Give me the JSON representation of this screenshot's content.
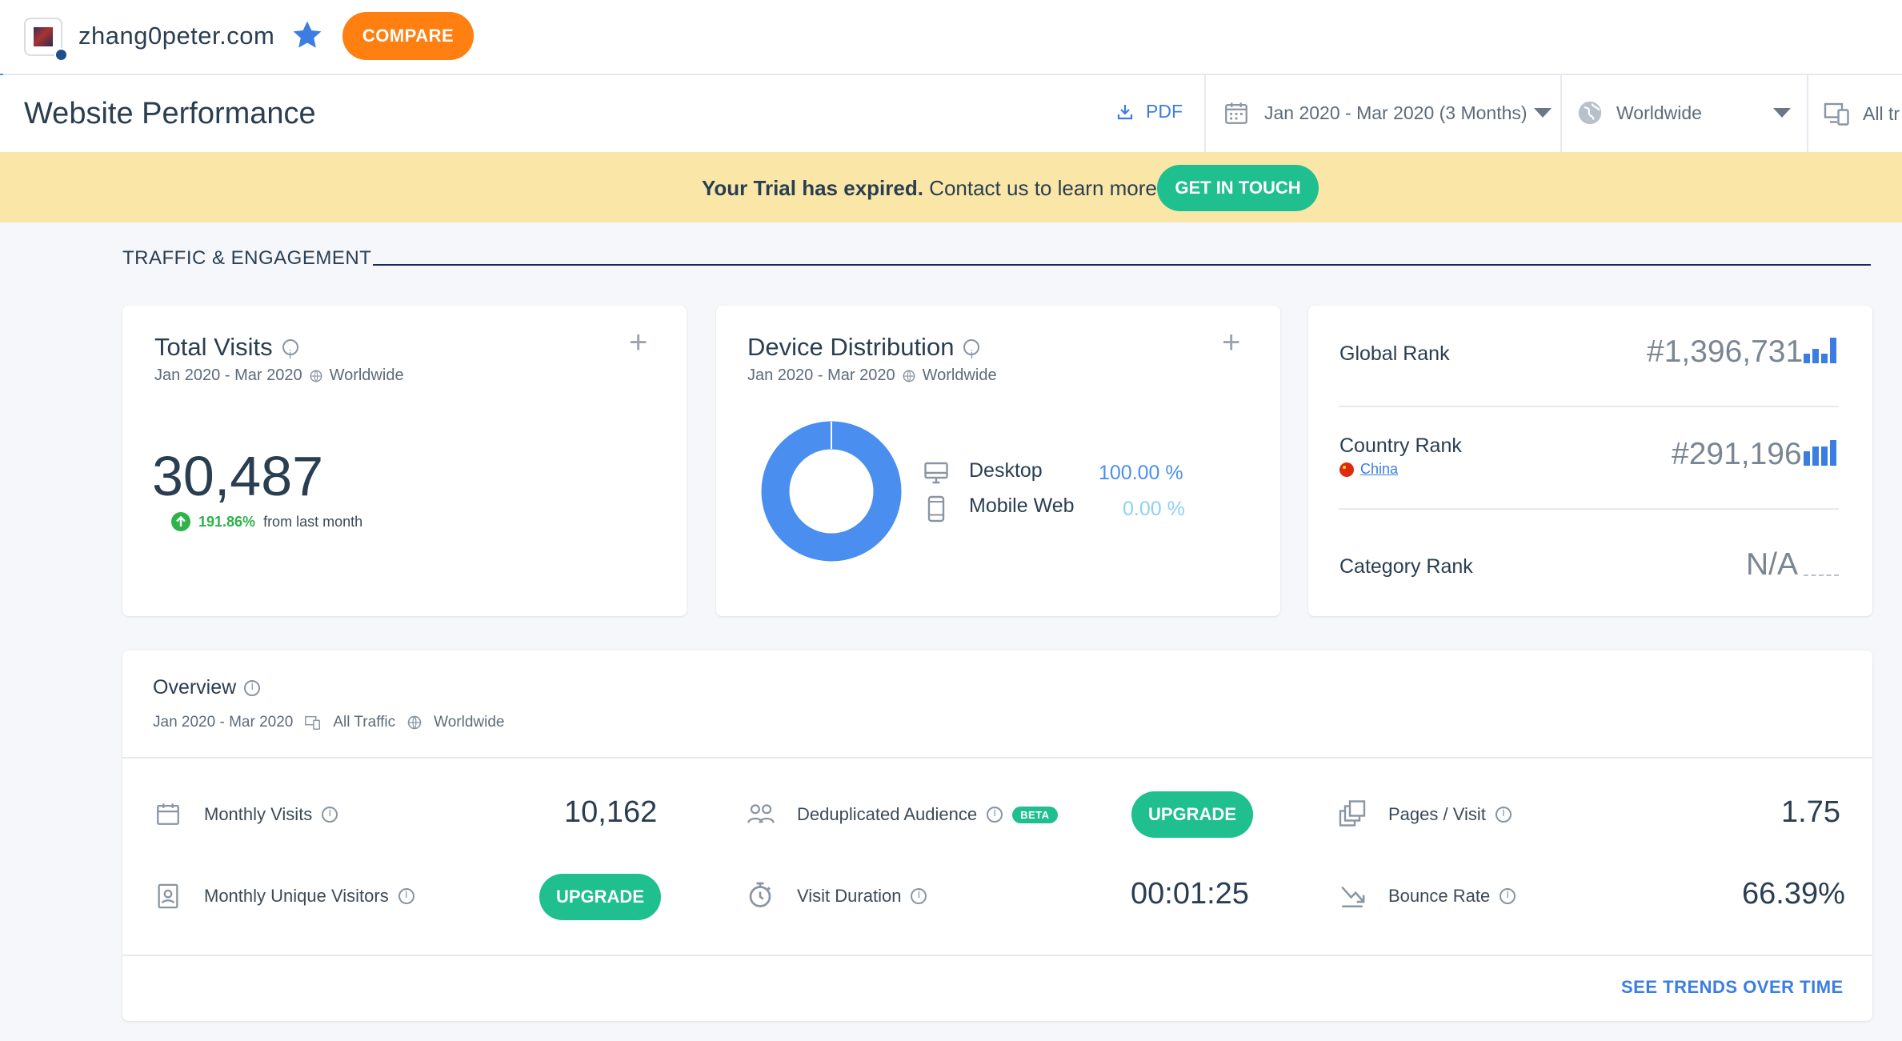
{
  "topbar": {
    "domain": "zhang0peter.com",
    "compare_label": "COMPARE"
  },
  "header": {
    "title": "Website Performance",
    "pdf_label": "PDF",
    "date_range": "Jan 2020 - Mar 2020 (3 Months)",
    "geo": "Worldwide",
    "traffic": "All tr"
  },
  "banner": {
    "strong_text": "Your Trial has expired.",
    "text": " Contact us to learn more",
    "button_label": "GET IN TOUCH"
  },
  "section": {
    "title": "TRAFFIC & ENGAGEMENT"
  },
  "total_visits": {
    "title": "Total Visits",
    "period": "Jan 2020 - Mar 2020",
    "geo": "Worldwide",
    "value": "30,487",
    "change_pct": "191.86%",
    "change_text": "from last month"
  },
  "device_distribution": {
    "title": "Device Distribution",
    "period": "Jan 2020 - Mar 2020",
    "geo": "Worldwide",
    "desktop_label": "Desktop",
    "desktop_value": "100.00 %",
    "mobile_label": "Mobile Web",
    "mobile_value": "0.00 %",
    "desktop_share": 1.0,
    "colors": {
      "desktop": "#4a8ff0",
      "mobile": "#8fd0f5"
    }
  },
  "ranks": {
    "global_label": "Global Rank",
    "global_value": "#1,396,731",
    "country_label": "Country Rank",
    "country_name": "China",
    "country_value": "#291,196",
    "category_label": "Category Rank",
    "category_value": "N/A"
  },
  "overview": {
    "title": "Overview",
    "period": "Jan 2020 - Mar 2020",
    "traffic": "All Traffic",
    "geo": "Worldwide",
    "monthly_visits_label": "Monthly Visits",
    "monthly_visits_value": "10,162",
    "unique_visitors_label": "Monthly Unique Visitors",
    "unique_upgrade_label": "UPGRADE",
    "dedup_label": "Deduplicated Audience",
    "beta_label": "BETA",
    "dedup_upgrade_label": "UPGRADE",
    "visit_duration_label": "Visit Duration",
    "visit_duration_value": "00:01:25",
    "pages_visit_label": "Pages / Visit",
    "pages_visit_value": "1.75",
    "bounce_rate_label": "Bounce Rate",
    "bounce_rate_value": "66.39%",
    "trends_link": "SEE TRENDS OVER TIME"
  },
  "colors": {
    "accent_blue": "#3b7de0",
    "compare_orange": "#ff7f11",
    "upgrade_green": "#1fbf8f",
    "banner_yellow": "#fae7a8",
    "positive_green": "#2db34a"
  }
}
